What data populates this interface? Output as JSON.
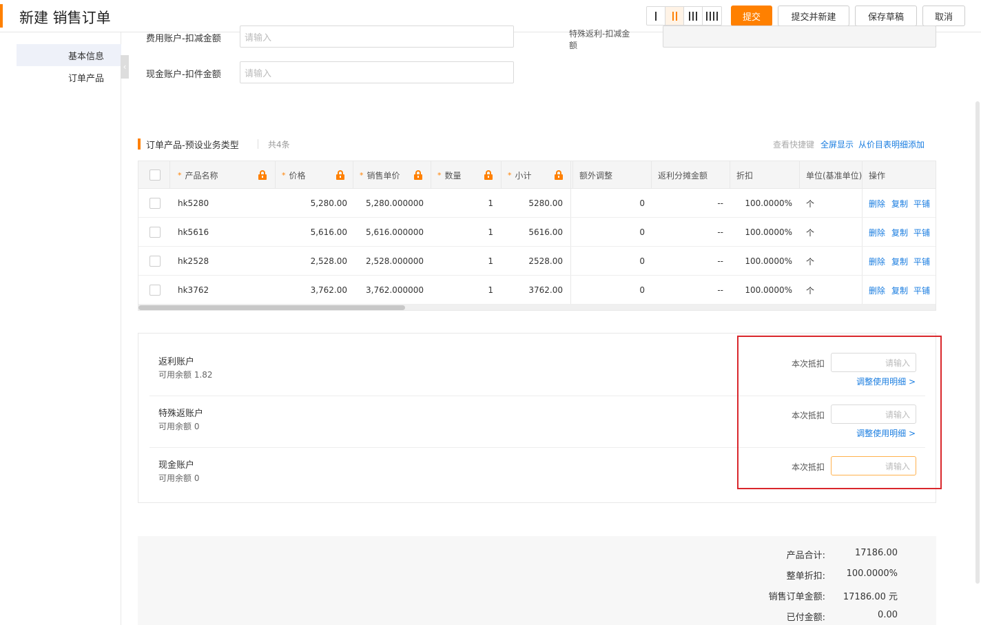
{
  "header": {
    "title": "新建 销售订单",
    "buttons": {
      "submit": "提交",
      "submit_new": "提交并新建",
      "save_draft": "保存草稿",
      "cancel": "取消"
    }
  },
  "sidenav": {
    "items": [
      "基本信息",
      "订单产品"
    ]
  },
  "form": {
    "fee_account_label": "费用账户-扣减金额",
    "fee_account_placeholder": "请输入",
    "cash_account_label": "现金账户-扣件金额",
    "cash_account_placeholder": "请输入",
    "special_label_line1": "特殊返利-扣减金",
    "special_label_line2": "额"
  },
  "section": {
    "title": "订单产品-预设业务类型",
    "count": "共4条",
    "links": {
      "shortcuts": "查看快捷键",
      "fullscreen": "全屏显示",
      "add_from_price": "从价目表明细添加"
    }
  },
  "table": {
    "headers": {
      "name": "产品名称",
      "price": "价格",
      "unit_price": "销售单价",
      "qty": "数量",
      "subtotal": "小计",
      "extra": "额外调整",
      "rebate_share": "返利分摊金额",
      "discount": "折扣",
      "unit": "单位(基准单位)",
      "ops": "操作"
    },
    "required_mark": "*",
    "rows": [
      {
        "name": "hk5280",
        "price": "5,280.00",
        "unit_price": "5,280.000000",
        "qty": "1",
        "subtotal": "5280.00",
        "extra": "0",
        "rebate_share": "--",
        "discount": "100.0000%",
        "unit": "个"
      },
      {
        "name": "hk5616",
        "price": "5,616.00",
        "unit_price": "5,616.000000",
        "qty": "1",
        "subtotal": "5616.00",
        "extra": "0",
        "rebate_share": "--",
        "discount": "100.0000%",
        "unit": "个"
      },
      {
        "name": "hk2528",
        "price": "2,528.00",
        "unit_price": "2,528.000000",
        "qty": "1",
        "subtotal": "2528.00",
        "extra": "0",
        "rebate_share": "--",
        "discount": "100.0000%",
        "unit": "个"
      },
      {
        "name": "hk3762",
        "price": "3,762.00",
        "unit_price": "3,762.000000",
        "qty": "1",
        "subtotal": "3762.00",
        "extra": "0",
        "rebate_share": "--",
        "discount": "100.0000%",
        "unit": "个"
      }
    ],
    "ops": {
      "delete": "删除",
      "copy": "复制",
      "spread": "平铺"
    }
  },
  "accounts": {
    "deduct_label": "本次抵扣",
    "placeholder": "请输入",
    "detail_link": "调整使用明细 >",
    "items": [
      {
        "name": "返利账户",
        "balance": "可用余额 1.82"
      },
      {
        "name": "特殊返账户",
        "balance": "可用余额 0"
      },
      {
        "name": "现金账户",
        "balance": "可用余额 0"
      }
    ]
  },
  "summary": {
    "product_total_label": "产品合计:",
    "product_total": "17186.00",
    "order_discount_label": "整单折扣:",
    "order_discount": "100.0000%",
    "order_amount_label": "销售订单金额:",
    "order_amount": "17186.00 元",
    "paid_label": "已付金额:",
    "paid": "0.00"
  },
  "colors": {
    "accent": "#ff8000",
    "link": "#1a7de0",
    "highlight": "#d9262b"
  }
}
